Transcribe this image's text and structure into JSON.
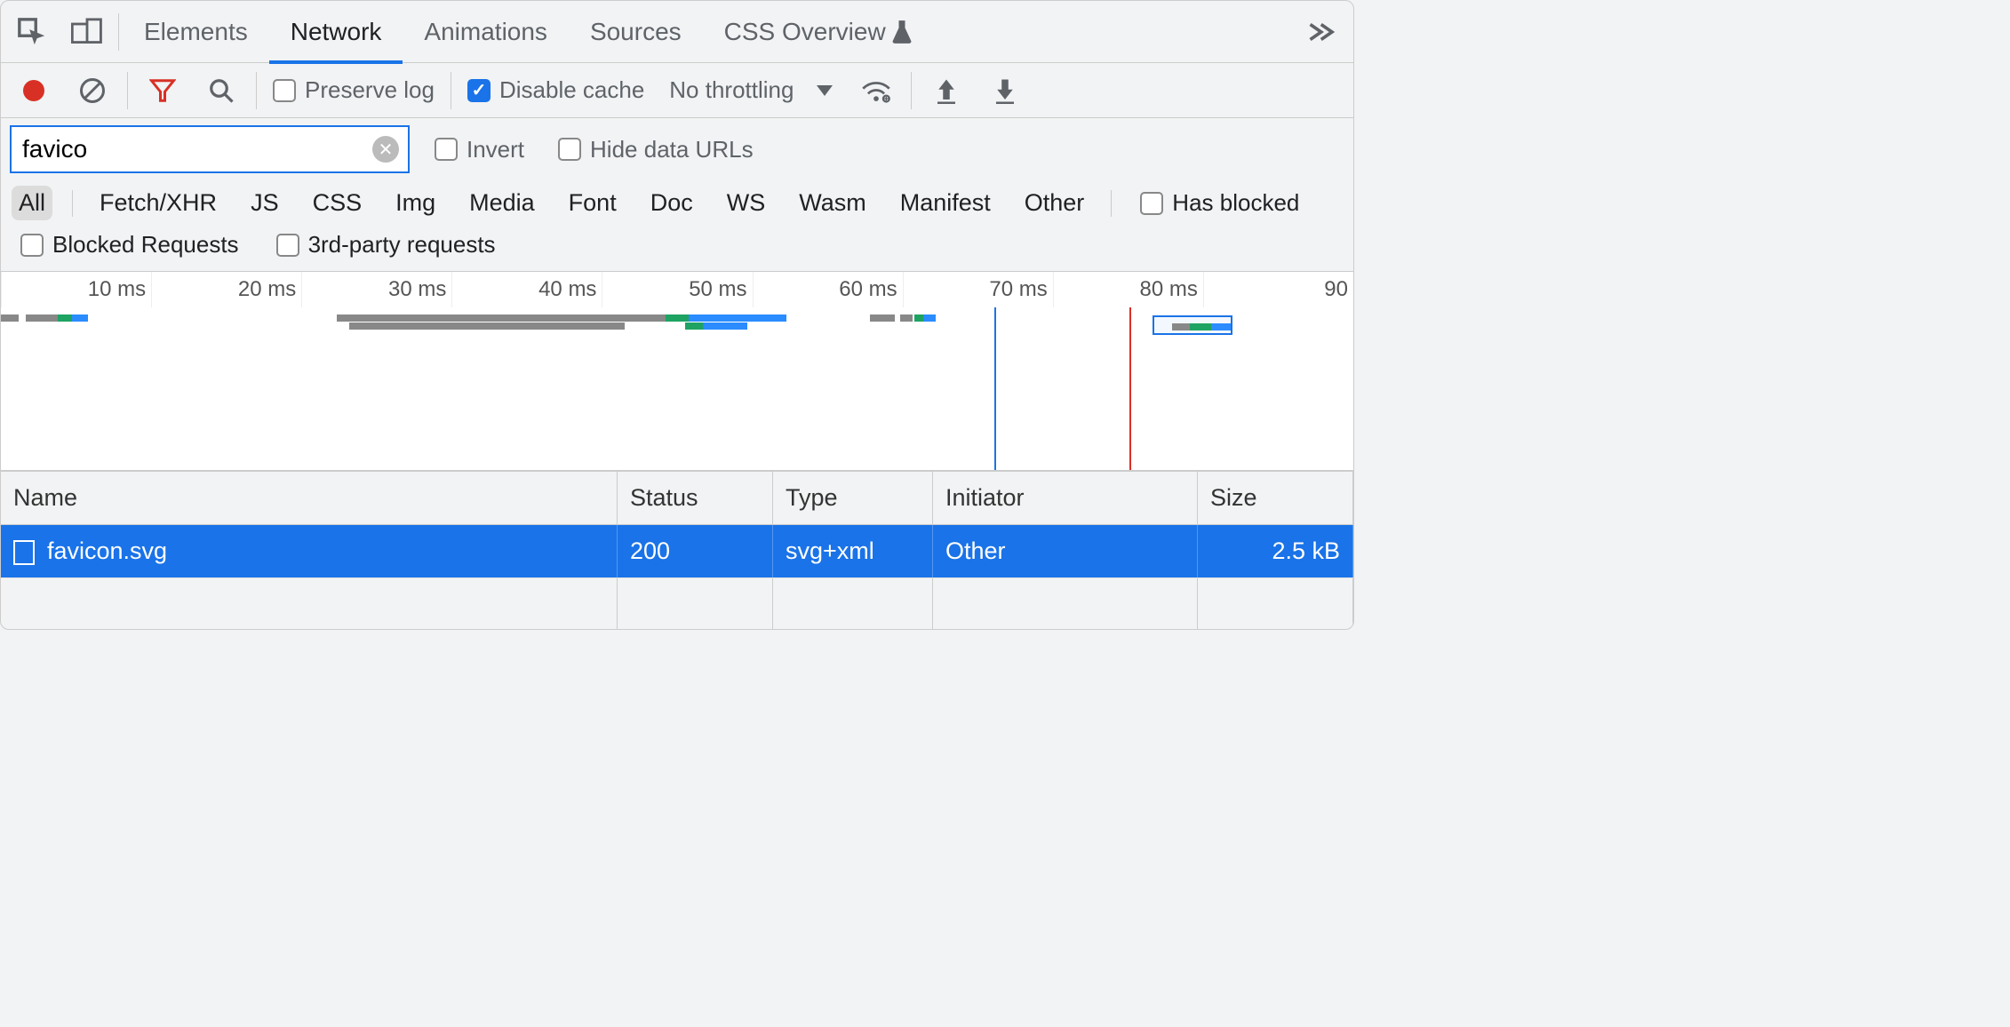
{
  "tabs": {
    "elements": "Elements",
    "network": "Network",
    "animations": "Animations",
    "sources": "Sources",
    "css_overview": "CSS Overview"
  },
  "toolbar": {
    "preserve_log": "Preserve log",
    "disable_cache": "Disable cache",
    "throttling": "No throttling"
  },
  "filter": {
    "value": "favico",
    "invert": "Invert",
    "hide_data_urls": "Hide data URLs"
  },
  "categories": [
    "All",
    "Fetch/XHR",
    "JS",
    "CSS",
    "Img",
    "Media",
    "Font",
    "Doc",
    "WS",
    "Wasm",
    "Manifest",
    "Other"
  ],
  "extra_filters": {
    "has_blocked": "Has blocked",
    "blocked_requests": "Blocked Requests",
    "third_party": "3rd-party requests"
  },
  "timeline_ticks": [
    "10 ms",
    "20 ms",
    "30 ms",
    "40 ms",
    "50 ms",
    "60 ms",
    "70 ms",
    "80 ms",
    "90 "
  ],
  "columns": {
    "name": "Name",
    "status": "Status",
    "type": "Type",
    "initiator": "Initiator",
    "size": "Size"
  },
  "rows": [
    {
      "name": "favicon.svg",
      "status": "200",
      "type": "svg+xml",
      "initiator": "Other",
      "size": "2.5 kB"
    }
  ]
}
